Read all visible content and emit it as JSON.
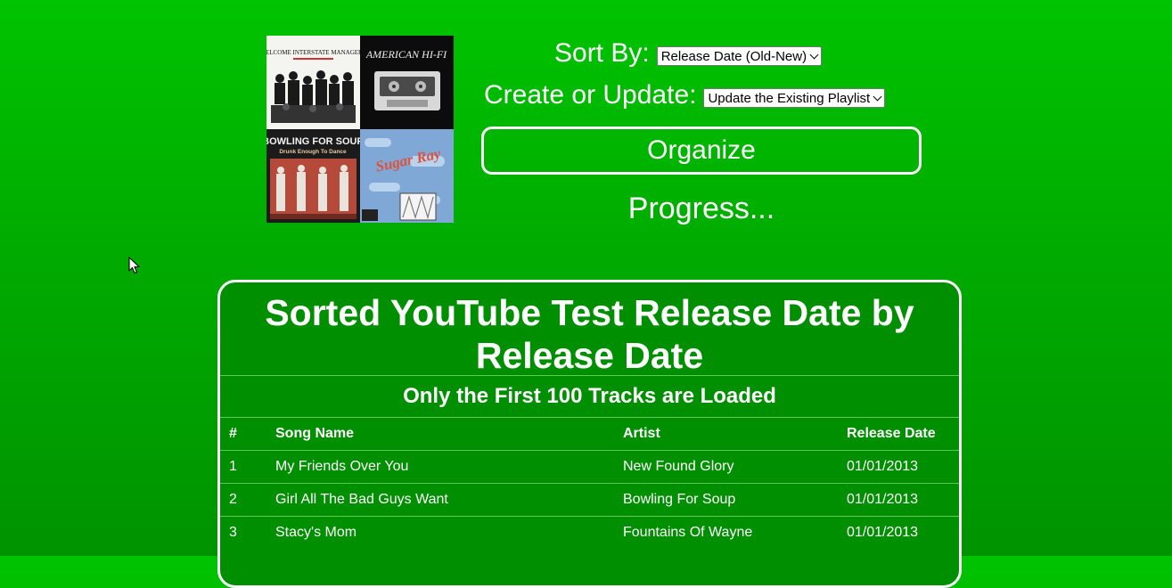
{
  "controls": {
    "sort_label": "Sort By:",
    "sort_value": "Release Date (Old-New)",
    "create_label": "Create or Update:",
    "create_value": "Update the Existing Playlist",
    "organize_label": "Organize",
    "progress_text": "Progress..."
  },
  "album_covers": {
    "cover1_text": "WELCOME INTERSTATE MANAGERS",
    "cover2_text": "AMERICAN HI-FI",
    "cover3_text": "BOWLING FOR SOUP",
    "cover3_subtext": "Drunk Enough To Dance",
    "cover4_text": "Sugar Ray"
  },
  "playlist": {
    "title": "Sorted YouTube Test Release Date by Release Date",
    "subtitle": "Only the First 100 Tracks are Loaded",
    "columns": [
      "#",
      "Song Name",
      "Artist",
      "Release Date"
    ],
    "rows": [
      {
        "num": "1",
        "song": "My Friends Over You",
        "artist": "New Found Glory",
        "date": "01/01/2013"
      },
      {
        "num": "2",
        "song": "Girl All The Bad Guys Want",
        "artist": "Bowling For Soup",
        "date": "01/01/2013"
      },
      {
        "num": "3",
        "song": "Stacy's Mom",
        "artist": "Fountains Of Wayne",
        "date": "01/01/2013"
      }
    ]
  },
  "colors": {
    "background_top": "#00c300",
    "background_bottom": "#009300",
    "panel": "#008f00",
    "text": "#ffffff"
  }
}
